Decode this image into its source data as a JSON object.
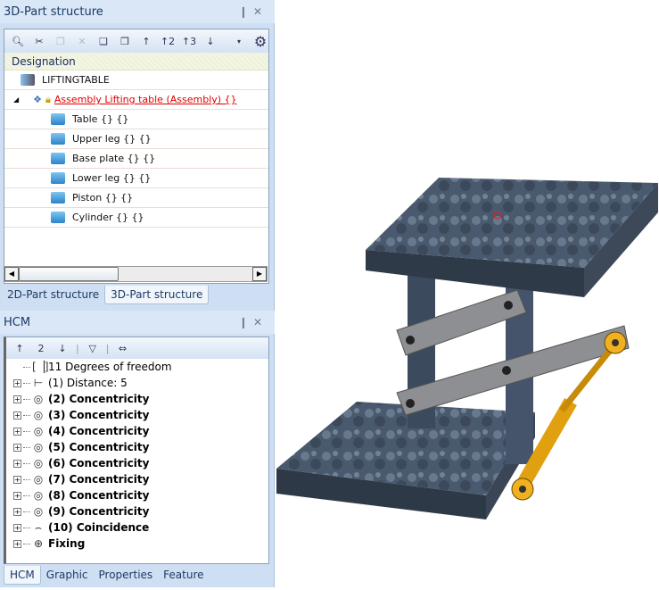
{
  "part_panel": {
    "title": "3D-Part structure",
    "pin": "❙",
    "close": "✕",
    "toolbar": [
      "search-icon",
      "cut-icon",
      "copy-icon",
      "delete-icon",
      "paste-icon",
      "paste-special-icon",
      "collapse-1-icon",
      "expand-2-icon",
      "expand-3-icon",
      "expand-all-icon"
    ],
    "column": "Designation",
    "root": "LIFTINGTABLE",
    "assembly": "Assembly Lifting table (Assembly) {}",
    "parts": [
      "Table {} {}",
      "Upper leg {} {}",
      "Base plate {} {}",
      "Lower leg {} {}",
      "Piston {} {}",
      "Cylinder {} {}"
    ],
    "tabs": [
      "2D-Part structure",
      "3D-Part structure"
    ],
    "active_tab": 1
  },
  "hcm_panel": {
    "title": "HCM",
    "dof": "11 Degrees of freedom",
    "items": [
      {
        "label": "(1) Distance: 5",
        "bold": false,
        "icon": "⊢"
      },
      {
        "label": "(2) Concentricity",
        "bold": true,
        "icon": "◎"
      },
      {
        "label": "(3) Concentricity",
        "bold": true,
        "icon": "◎"
      },
      {
        "label": "(4) Concentricity",
        "bold": true,
        "icon": "◎"
      },
      {
        "label": "(5) Concentricity",
        "bold": true,
        "icon": "◎"
      },
      {
        "label": "(6) Concentricity",
        "bold": true,
        "icon": "◎"
      },
      {
        "label": "(7) Concentricity",
        "bold": true,
        "icon": "◎"
      },
      {
        "label": "(8) Concentricity",
        "bold": true,
        "icon": "◎"
      },
      {
        "label": "(9) Concentricity",
        "bold": true,
        "icon": "◎"
      },
      {
        "label": "(10) Coincidence",
        "bold": true,
        "icon": "⌢"
      },
      {
        "label": "Fixing",
        "bold": true,
        "icon": "⊕"
      }
    ],
    "tabs": [
      "HCM",
      "Graphic",
      "Properties",
      "Feature"
    ],
    "active_tab": 0
  },
  "colors": {
    "panel": "#cfdff3",
    "link": "#e00000",
    "steel": "#3e4c5e",
    "arm": "#8b8d8f",
    "piston": "#e8a416"
  }
}
